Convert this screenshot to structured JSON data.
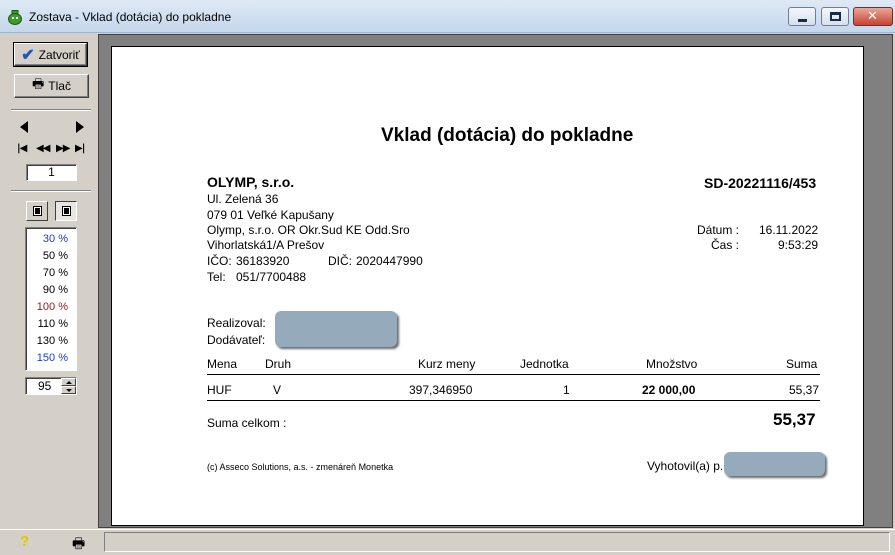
{
  "window": {
    "title": "Zostava - Vklad (dotácia) do pokladne"
  },
  "toolbar": {
    "close_label": "Zatvoriť",
    "print_label": "Tlač",
    "page_number": "1",
    "zoom_options": [
      "30 %",
      "50 %",
      "70 %",
      "90 %",
      "100 %",
      "110 %",
      "130 %",
      "150 %"
    ],
    "zoom_value": "95"
  },
  "document": {
    "title": "Vklad (dotácia) do pokladne",
    "company": {
      "name": "OLYMP, s.r.o.",
      "street": "Ul. Zelená 36",
      "city": "079 01 Veľké Kapušany",
      "register": "Olymp, s.r.o. OR Okr.Sud KE Odd.Sro",
      "register2": "Vihorlatská1/A Prešov",
      "ico_label": "IČO:",
      "ico": "36183920",
      "dic_label": "DIČ:",
      "dic": "2020447990",
      "tel_label": "Tel:",
      "tel": "051/7700488"
    },
    "doc_number": "SD-20221116/453",
    "date_label": "Dátum :",
    "date": "16.11.2022",
    "time_label": "Čas :",
    "time": "9:53:29",
    "realized_label": "Realizoval:",
    "supplier_label": "Dodávateľ:",
    "table": {
      "headers": [
        "Mena",
        "Druh",
        "Kurz meny",
        "Jednotka",
        "Množstvo",
        "Suma"
      ],
      "rows": [
        {
          "currency": "HUF",
          "kind": "V",
          "rate": "397,346950",
          "unit": "1",
          "amount": "22 000,00",
          "sum": "55,37"
        }
      ]
    },
    "total_label": "Suma celkom :",
    "total": "55,37",
    "footer_note": "(c) Asseco Solutions, a.s. - zmenáreň Monetka",
    "made_by_label": "Vyhotovil(a) p."
  }
}
